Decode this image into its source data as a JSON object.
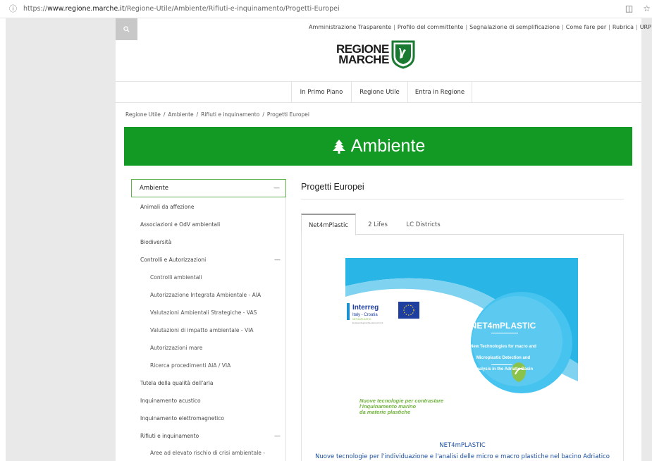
{
  "browser": {
    "url_prefix": "https://",
    "url_host": "www.regione.marche.it",
    "url_path": "/Regione-Utile/Ambiente/Rifiuti-e-inquinamento/Progetti-Europei"
  },
  "header": {
    "top_links": [
      "Amministrazione Trasparente",
      "Profilo del committente",
      "Segnalazione di semplificazione",
      "Come fare per",
      "Rubrica",
      "URP"
    ],
    "logo_line1": "REGIONE",
    "logo_line2": "MARCHE"
  },
  "nav": {
    "items": [
      "In Primo Piano",
      "Regione Utile",
      "Entra in Regione"
    ]
  },
  "breadcrumb": [
    "Regione Utile",
    "Ambiente",
    "Rifiuti e inquinamento",
    "Progetti Europei"
  ],
  "banner": {
    "title": "Ambiente"
  },
  "sidebar": {
    "heading": "Ambiente",
    "items": [
      {
        "label": "Animali da affezione",
        "sub": false
      },
      {
        "label": "Associazioni e OdV ambientali",
        "sub": false
      },
      {
        "label": "Biodiversità",
        "sub": false
      },
      {
        "label": "Controlli e Autorizzazioni",
        "sub": false,
        "expanded": true
      },
      {
        "label": "Controlli ambientali",
        "sub": true
      },
      {
        "label": "Autorizzazione Integrata Ambientale - AIA",
        "sub": true
      },
      {
        "label": "Valutazioni Ambientali Strategiche - VAS",
        "sub": true
      },
      {
        "label": "Valutazioni di impatto ambientale - VIA",
        "sub": true
      },
      {
        "label": "Autorizzazioni mare",
        "sub": true
      },
      {
        "label": "Ricerca procedimenti AIA / VIA",
        "sub": true
      },
      {
        "label": "Tutela della qualità dell'aria",
        "sub": false
      },
      {
        "label": "Inquinamento acustico",
        "sub": false
      },
      {
        "label": "Inquinamento elettromagnetico",
        "sub": false
      },
      {
        "label": "Rifiuti e inquinamento",
        "sub": false,
        "expanded": true
      },
      {
        "label": "Aree ad elevato rischio di crisi ambientale -",
        "sub": true
      }
    ]
  },
  "main": {
    "title": "Progetti Europei",
    "tabs": [
      "Net4mPlastic",
      "2 Lifes",
      "LC Districts"
    ],
    "active_tab": "Net4mPlastic",
    "poster": {
      "interreg": "Interreg",
      "program": "Italy - Croatia",
      "project_small": "NET4mPLASTIC",
      "fund_note": "European Regional Development Fund",
      "circle_title": "NET4mPLASTIC",
      "circle_line1": "New Technologies for macro and",
      "circle_line2": "Microplastic Detection and",
      "circle_line3": "Analysis in the Adriatic Basin",
      "green_line1": "Nuove tecnologie per contrastare",
      "green_line2": "l'inquinamento marino",
      "green_line3": "da materie plastiche"
    },
    "content_heading": "NET4mPLASTIC",
    "content_sub": "Nuove tecnologie per l'individuazione e l'analisi delle micro e macro plastiche nel bacino Adriatico"
  },
  "colors": {
    "banner_green": "#129a24",
    "sidebar_active_border": "#5fb24e",
    "link_blue": "#1a4ea3",
    "poster_cyan": "#29b6e6"
  }
}
